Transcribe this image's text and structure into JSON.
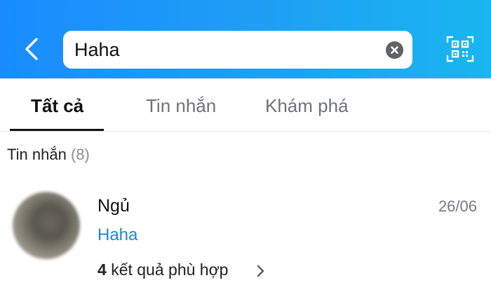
{
  "header": {
    "back_icon": "chevron-left-icon",
    "search": {
      "value": "Haha",
      "placeholder": ""
    },
    "clear_icon": "clear-x-icon",
    "qr_icon": "qr-code-icon",
    "colors": {
      "gradient_start": "#1a8cff",
      "gradient_end": "#19b6f0"
    }
  },
  "tabs": [
    {
      "label": "Tất cả",
      "active": true
    },
    {
      "label": "Tin nhắn",
      "active": false
    },
    {
      "label": "Khám phá",
      "active": false
    }
  ],
  "section": {
    "title": "Tin nhắn",
    "count": "(8)"
  },
  "result": {
    "name": "Ngủ",
    "date": "26/06",
    "snippet": "Haha",
    "match_count": "4",
    "match_text": "kết quả phù hợp",
    "snippet_color": "#1e88d8"
  }
}
